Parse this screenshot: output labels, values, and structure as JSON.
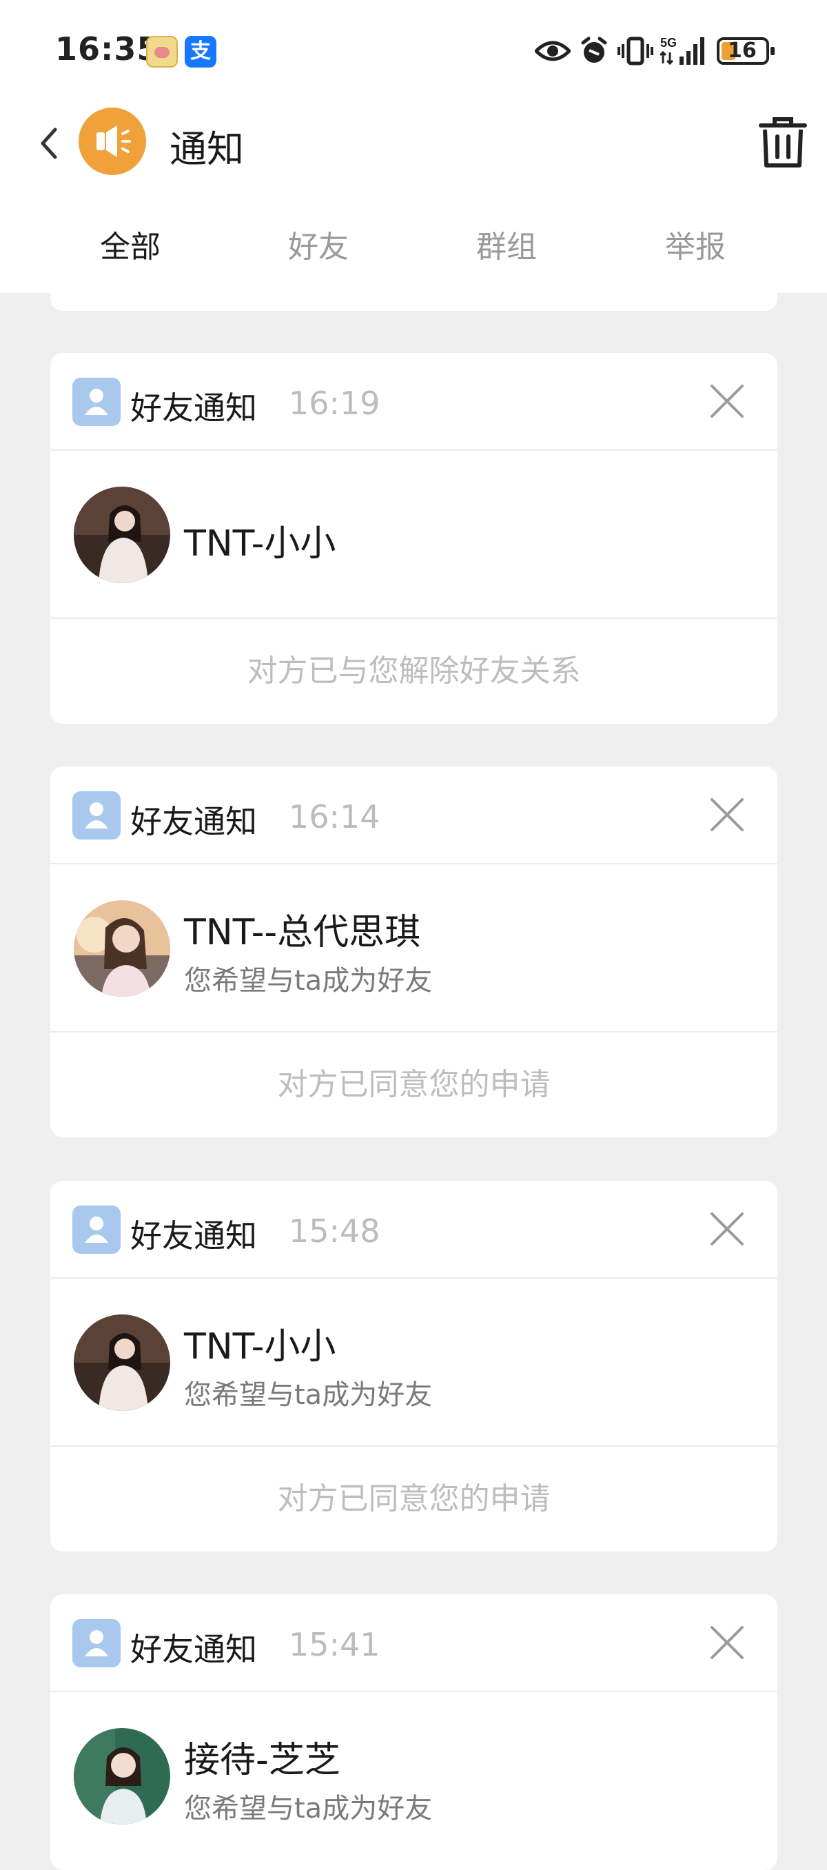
{
  "status_bar": {
    "time": "16:35",
    "alipay_glyph": "支",
    "battery_level": "16",
    "network": "5G",
    "icons": [
      "game-app-icon",
      "alipay-icon",
      "eye-icon",
      "alarm-icon",
      "vibrate-icon",
      "signal-icon",
      "battery-icon"
    ]
  },
  "header": {
    "title": "通知",
    "icons": [
      "back-arrow-icon",
      "megaphone-icon",
      "trash-icon"
    ]
  },
  "tabs": [
    {
      "label": "全部",
      "active": true
    },
    {
      "label": "好友",
      "active": false
    },
    {
      "label": "群组",
      "active": false
    },
    {
      "label": "举报",
      "active": false
    }
  ],
  "notifications": [
    {
      "type": "好友通知",
      "time": "16:19",
      "user_name": "TNT-小小",
      "message": "",
      "result": "对方已与您解除好友关系"
    },
    {
      "type": "好友通知",
      "time": "16:14",
      "user_name": "TNT--总代思琪",
      "message": "您希望与ta成为好友",
      "result": "对方已同意您的申请"
    },
    {
      "type": "好友通知",
      "time": "15:48",
      "user_name": "TNT-小小",
      "message": "您希望与ta成为好友",
      "result": "对方已同意您的申请"
    },
    {
      "type": "好友通知",
      "time": "15:41",
      "user_name": "接待-芝芝",
      "message": "您希望与ta成为好友",
      "result": ""
    }
  ],
  "colors": {
    "accent_orange": "#f0a13a",
    "friend_icon_blue": "#a8c8ee",
    "page_background": "#efefef"
  }
}
